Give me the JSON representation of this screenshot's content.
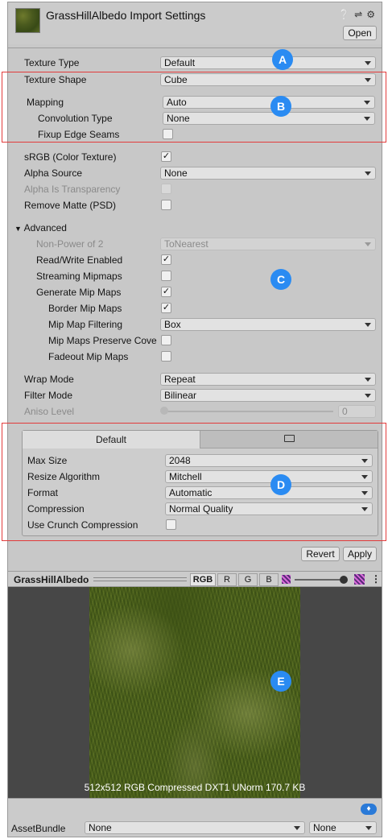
{
  "header": {
    "title": "GrassHillAlbedo Import Settings",
    "open_label": "Open",
    "icons": [
      "help-icon",
      "preset-icon",
      "gear-icon"
    ]
  },
  "fields": {
    "texture_type": {
      "label": "Texture Type",
      "value": "Default"
    },
    "texture_shape": {
      "label": "Texture Shape",
      "value": "Cube"
    },
    "mapping": {
      "label": "Mapping",
      "value": "Auto"
    },
    "convolution_type": {
      "label": "Convolution Type",
      "value": "None"
    },
    "fixup_edge_seams": {
      "label": "Fixup Edge Seams",
      "checked": false
    },
    "srgb": {
      "label": "sRGB (Color Texture)",
      "checked": true
    },
    "alpha_source": {
      "label": "Alpha Source",
      "value": "None"
    },
    "alpha_is_transparency": {
      "label": "Alpha Is Transparency",
      "checked": false
    },
    "remove_matte": {
      "label": "Remove Matte (PSD)",
      "checked": false
    },
    "advanced": {
      "label": "Advanced"
    },
    "non_power_of_2": {
      "label": "Non-Power of 2",
      "value": "ToNearest"
    },
    "read_write": {
      "label": "Read/Write Enabled",
      "checked": true
    },
    "streaming_mipmaps": {
      "label": "Streaming Mipmaps",
      "checked": false
    },
    "generate_mip_maps": {
      "label": "Generate Mip Maps",
      "checked": true
    },
    "border_mip_maps": {
      "label": "Border Mip Maps",
      "checked": true
    },
    "mip_map_filtering": {
      "label": "Mip Map Filtering",
      "value": "Box"
    },
    "mip_maps_preserve": {
      "label": "Mip Maps Preserve Cove",
      "checked": false
    },
    "fadeout_mip_maps": {
      "label": "Fadeout Mip Maps",
      "checked": false
    },
    "wrap_mode": {
      "label": "Wrap Mode",
      "value": "Repeat"
    },
    "filter_mode": {
      "label": "Filter Mode",
      "value": "Bilinear"
    },
    "aniso_level": {
      "label": "Aniso Level",
      "value": "0"
    }
  },
  "platform": {
    "tab_default": "Default",
    "max_size": {
      "label": "Max Size",
      "value": "2048"
    },
    "resize_algorithm": {
      "label": "Resize Algorithm",
      "value": "Mitchell"
    },
    "format": {
      "label": "Format",
      "value": "Automatic"
    },
    "compression": {
      "label": "Compression",
      "value": "Normal Quality"
    },
    "use_crunch": {
      "label": "Use Crunch Compression",
      "checked": false
    }
  },
  "actions": {
    "revert": "Revert",
    "apply": "Apply"
  },
  "preview": {
    "name": "GrassHillAlbedo",
    "channels": [
      "RGB",
      "R",
      "G",
      "B"
    ],
    "info": "512x512  RGB Compressed DXT1 UNorm   170.7 KB"
  },
  "footer": {
    "asset_bundle_label": "AssetBundle",
    "bundle_value": "None",
    "variant_value": "None"
  },
  "callouts": [
    "A",
    "B",
    "C",
    "D",
    "E"
  ],
  "colors": {
    "callout": "#2a8bf2",
    "highlight_box": "#e23b3b"
  }
}
